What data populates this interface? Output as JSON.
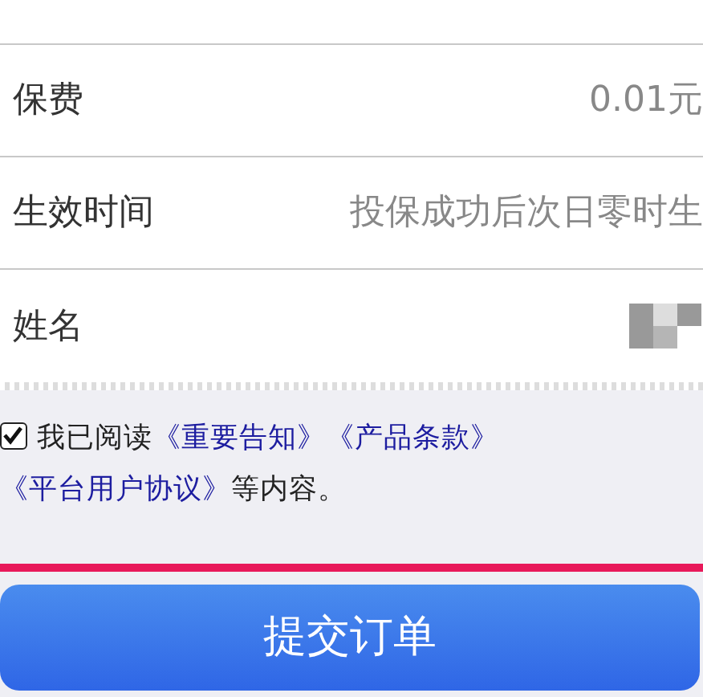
{
  "rows": [
    {
      "kind": "value",
      "label": "保费",
      "value": "0.01元"
    },
    {
      "kind": "value",
      "label": "生效时间",
      "value": "投保成功后次日零时生"
    },
    {
      "kind": "redacted",
      "label": "姓名"
    }
  ],
  "agreement": {
    "checked": true,
    "parts": [
      {
        "kind": "text",
        "text": "我已阅读"
      },
      {
        "kind": "link",
        "text": "《重要告知》"
      },
      {
        "kind": "link",
        "text": "《产品条款》"
      },
      {
        "kind": "link",
        "text": "《平台用户协议》"
      },
      {
        "kind": "text",
        "text": "等内容。"
      }
    ]
  },
  "submit_button": "提交订单"
}
